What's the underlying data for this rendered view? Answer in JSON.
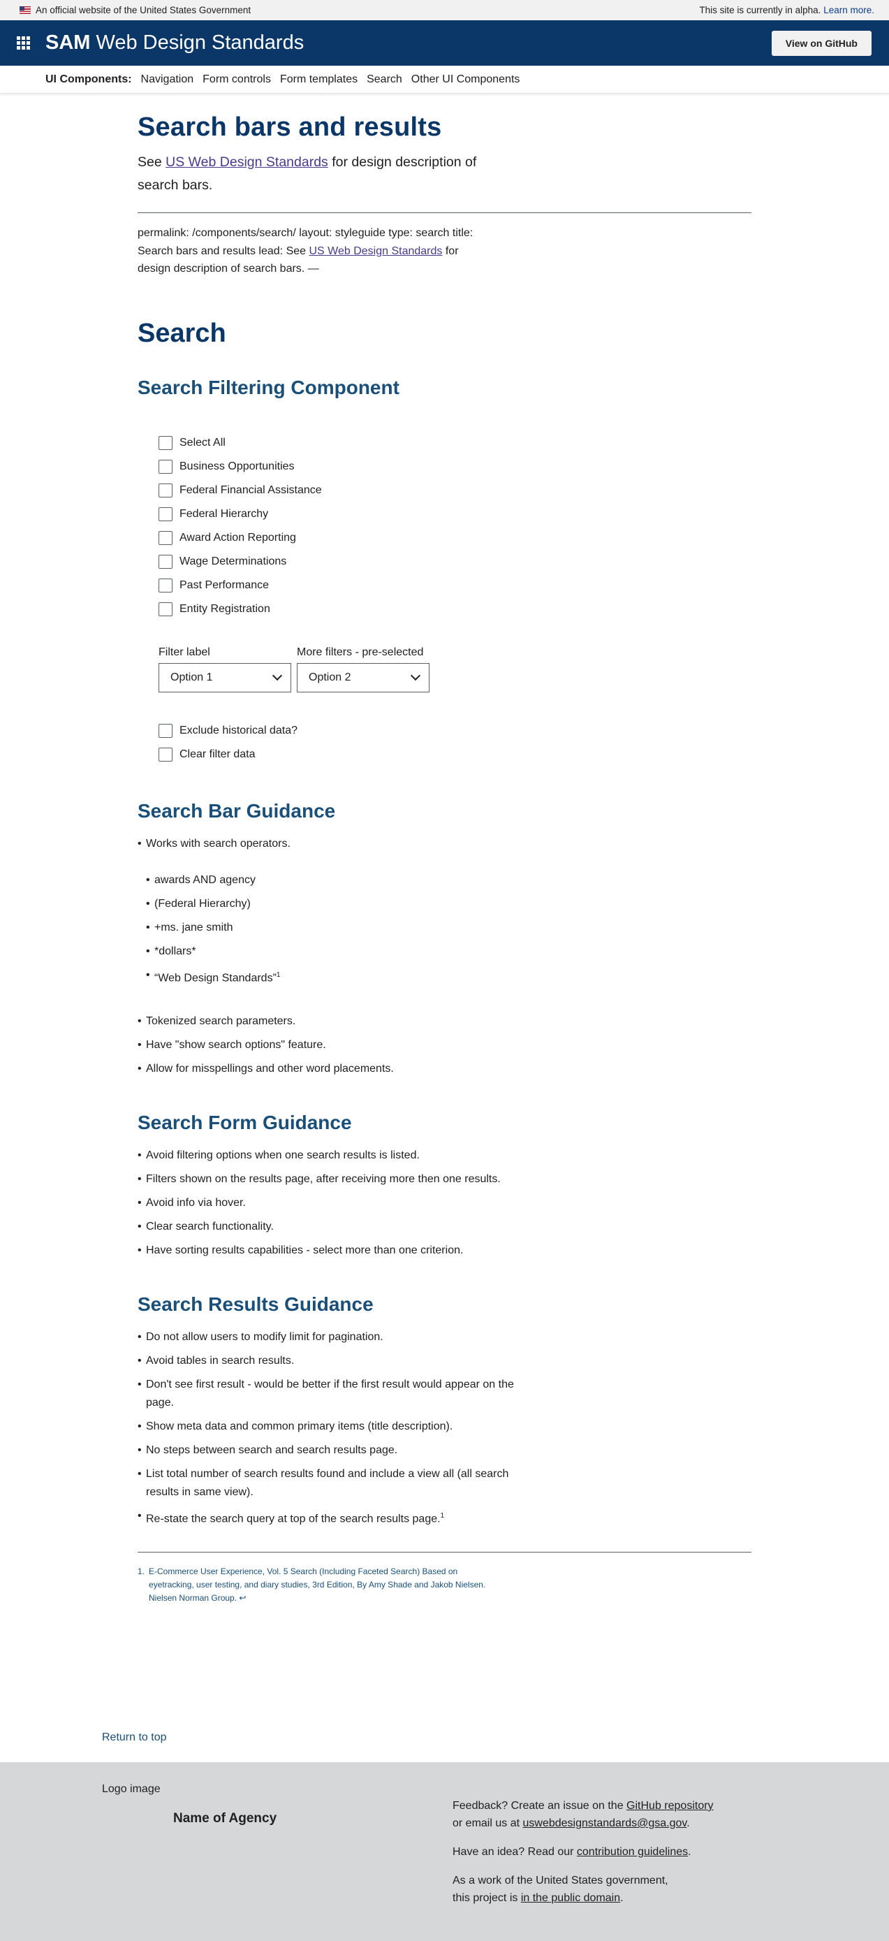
{
  "banner": {
    "official": "An official website of the United States Government",
    "alpha": "This site is currently in alpha.",
    "learn_more": "Learn more."
  },
  "header": {
    "brand_bold": "SAM",
    "brand_rest": " Web Design Standards",
    "github": "View on GitHub"
  },
  "subnav": {
    "label": "UI Components:",
    "items": [
      "Navigation",
      "Form controls",
      "Form templates",
      "Search",
      "Other UI Components"
    ]
  },
  "page": {
    "title": "Search bars and results",
    "lead_prefix": "See ",
    "lead_link": "US Web Design Standards",
    "lead_suffix": " for design description of search bars.",
    "meta_prefix": "permalink: /components/search/ layout: styleguide type: search title: Search bars and results lead: See ",
    "meta_link": "US Web Design Standards",
    "meta_suffix": " for design description of search bars. —"
  },
  "search": {
    "heading": "Search",
    "filter_heading": "Search Filtering Component",
    "checkboxes": [
      "Select All",
      "Business Opportunities",
      "Federal Financial Assistance",
      "Federal Hierarchy",
      "Award Action Reporting",
      "Wage Determinations",
      "Past Performance",
      "Entity Registration"
    ],
    "filter_label": "Filter label",
    "filter_value": "Option 1",
    "more_label": "More filters - pre-selected",
    "more_value": "Option 2",
    "extra_checkboxes": [
      "Exclude historical data?",
      "Clear filter data"
    ]
  },
  "bar_guidance": {
    "heading": "Search Bar Guidance",
    "intro": "Works with search operators.",
    "operators": [
      "awards AND agency",
      "(Federal Hierarchy)",
      "+ms. jane smith",
      "*dollars*",
      "“Web Design Standards”"
    ],
    "operators_footnote": "1",
    "more": [
      "Tokenized search parameters.",
      "Have \"show search options\" feature.",
      "Allow for misspellings and other word placements."
    ]
  },
  "form_guidance": {
    "heading": "Search Form Guidance",
    "items": [
      "Avoid filtering options when one search results is listed.",
      "Filters shown on the results page, after receiving more then one results.",
      "Avoid info via hover.",
      "Clear search functionality.",
      "Have sorting results capabilities - select more than one criterion."
    ]
  },
  "results_guidance": {
    "heading": "Search Results Guidance",
    "items": [
      "Do not allow users to modify limit for pagination.",
      "Avoid tables in search results.",
      "Don't see first result - would be better if the first result would appear on the page.",
      "Show meta data and common primary items (title description).",
      "No steps between search and search results page.",
      "List total number of search results found and include a view all (all search results in same view).",
      "Re-state the search query at top of the search results page."
    ],
    "last_footnote": "1"
  },
  "footnotes": {
    "number": "1.",
    "text": "E-Commerce User Experience, Vol. 5 Search (Including Faceted Search) Based on eyetracking, user testing, and diary studies, 3rd Edition, By Amy Shade and Jakob Nielsen. Nielsen Norman Group.",
    "back": "↩"
  },
  "return_to_top": "Return to top",
  "footer": {
    "logo": "Logo image",
    "agency": "Name of Agency",
    "feedback_prefix": "Feedback? Create an issue on the ",
    "feedback_link": "GitHub repository",
    "email_prefix": "or email us at ",
    "email_link": "uswebdesignstandards@gsa.gov",
    "email_suffix": ".",
    "idea_prefix": "Have an idea? Read our ",
    "idea_link": "contribution guidelines",
    "idea_suffix": ".",
    "gov_line1": "As a work of the United States government,",
    "gov_prefix": "this project is ",
    "gov_link": "in the public domain",
    "gov_suffix": "."
  }
}
